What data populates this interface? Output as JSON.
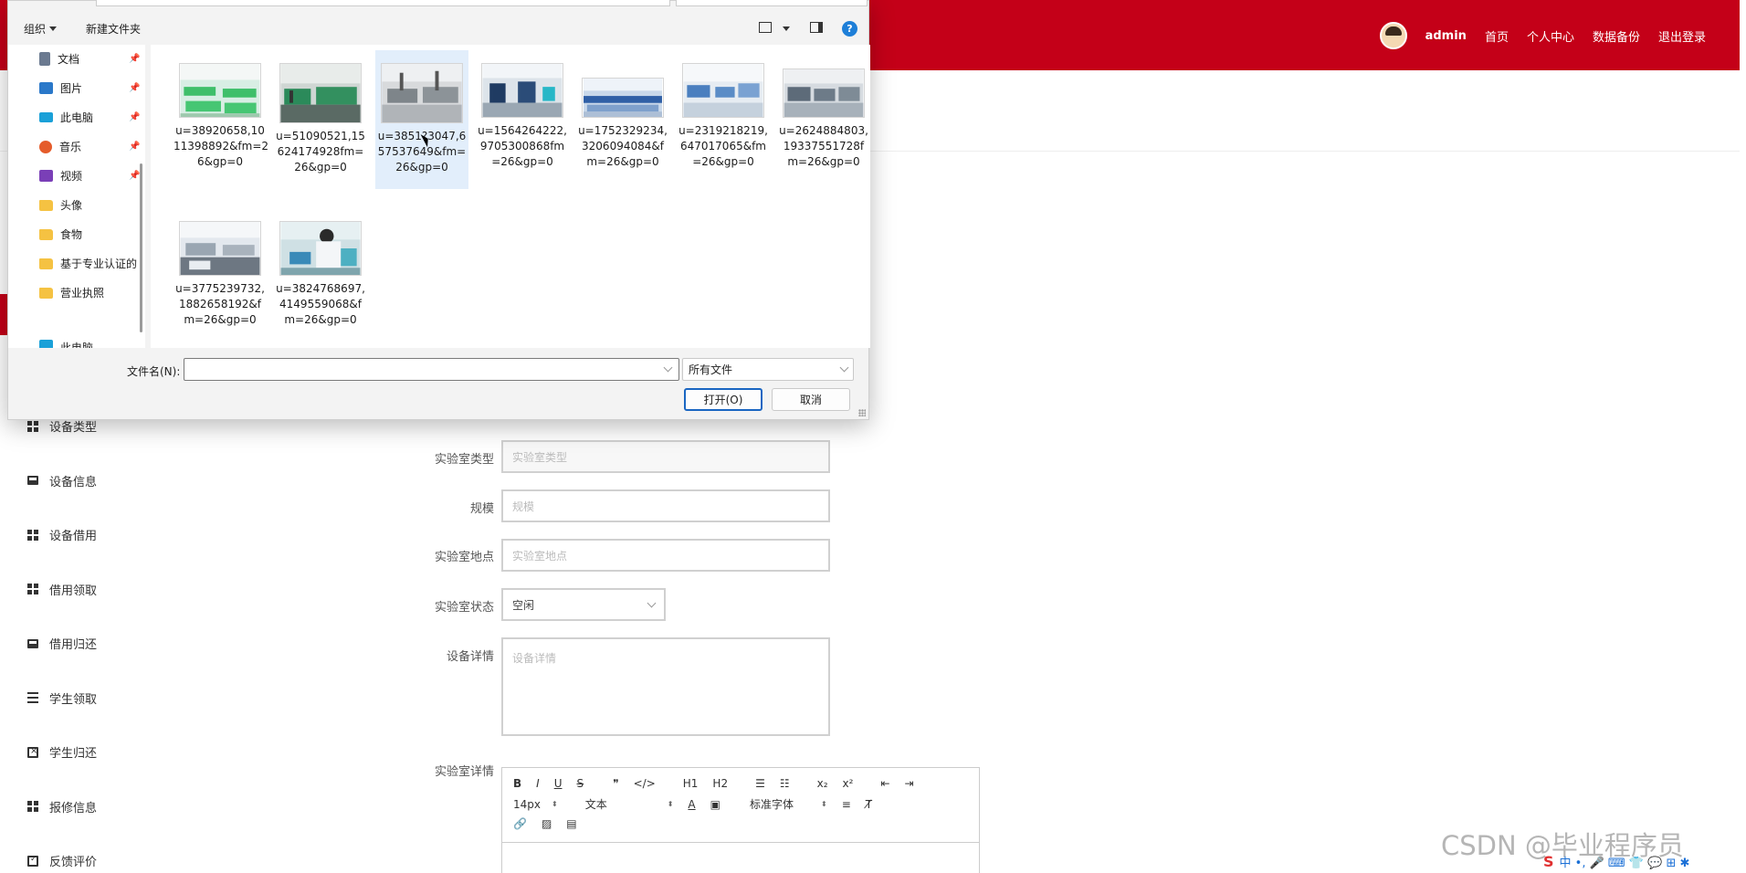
{
  "header": {
    "user": "admin",
    "nav": [
      "首页",
      "个人中心",
      "数据备份",
      "退出登录"
    ],
    "color": "#c40018"
  },
  "sidebar": {
    "items": [
      {
        "label": "设备类型",
        "icon": "grid-icon"
      },
      {
        "label": "设备信息",
        "icon": "monitor-icon"
      },
      {
        "label": "设备借用",
        "icon": "grid-icon"
      },
      {
        "label": "借用领取",
        "icon": "grid-icon"
      },
      {
        "label": "借用归还",
        "icon": "monitor-icon"
      },
      {
        "label": "学生领取",
        "icon": "list-icon"
      },
      {
        "label": "学生归还",
        "icon": "clipboard-x-icon"
      },
      {
        "label": "报修信息",
        "icon": "grid-icon"
      },
      {
        "label": "反馈评价",
        "icon": "clipboard-check-icon"
      }
    ]
  },
  "form": {
    "lab_type": {
      "label": "实验室类型",
      "placeholder": "实验室类型"
    },
    "scale": {
      "label": "规模",
      "placeholder": "规模"
    },
    "lab_location": {
      "label": "实验室地点",
      "placeholder": "实验室地点"
    },
    "lab_status": {
      "label": "实验室状态",
      "value": "空闲"
    },
    "device_detail": {
      "label": "设备详情",
      "placeholder": "设备详情"
    },
    "lab_detail": {
      "label": "实验室详情"
    }
  },
  "editor": {
    "toolbar_row1": [
      "B",
      "I",
      "U",
      "S",
      "❞",
      "</>",
      "H1",
      "H2",
      "ol",
      "ul",
      "x₂",
      "x²",
      "outdent",
      "indent"
    ],
    "font_size": "14px",
    "text_style": "文本",
    "font_family": "标准字体"
  },
  "dialog": {
    "toolbar": {
      "organize": "组织",
      "new_folder": "新建文件夹"
    },
    "nav_items": [
      {
        "label": "文档",
        "icon": "document-icon",
        "pinned": true
      },
      {
        "label": "图片",
        "icon": "pictures-icon",
        "pinned": true
      },
      {
        "label": "此电脑",
        "icon": "computer-icon",
        "pinned": true
      },
      {
        "label": "音乐",
        "icon": "music-icon",
        "pinned": true
      },
      {
        "label": "视频",
        "icon": "video-icon",
        "pinned": true
      },
      {
        "label": "头像",
        "icon": "folder-icon",
        "pinned": false
      },
      {
        "label": "食物",
        "icon": "folder-icon",
        "pinned": false
      },
      {
        "label": "基于专业认证的",
        "icon": "folder-icon",
        "pinned": false
      },
      {
        "label": "营业执照",
        "icon": "folder-icon",
        "pinned": false
      },
      {
        "label": "此电脑",
        "icon": "computer-icon",
        "pinned": false
      }
    ],
    "files": [
      {
        "name": "u=38920658,10 11398892&fm=2 6&gp=0",
        "selected": false
      },
      {
        "name": "u=51090521,15 624174928fm= 26&gp=0",
        "selected": false
      },
      {
        "name": "u=3851?3047,6 57537649&fm= 26&gp=0",
        "selected": true
      },
      {
        "name": "u=1564264222, 9705300868fm =26&gp=0",
        "selected": false
      },
      {
        "name": "u=1752329234, 3206094084&f m=26&gp=0",
        "selected": false
      },
      {
        "name": "u=2319218219, 647017065&fm =26&gp=0",
        "selected": false
      },
      {
        "name": "u=2624884803, 19337551728f m=26&gp=0",
        "selected": false
      },
      {
        "name": "u=3775239732, 1882658192&f m=26&gp=0",
        "selected": false
      },
      {
        "name": "u=3824768697, 4149559068&f m=26&gp=0",
        "selected": false
      }
    ],
    "filename_label": "文件名(N):",
    "filename_value": "",
    "filetype": "所有文件",
    "open_button": "打开(O)",
    "cancel_button": "取消"
  },
  "watermark": "CSDN @毕业程序员",
  "tray": "中 •, 🎤 ⌨ 👕 💬 ⊞ ✱"
}
